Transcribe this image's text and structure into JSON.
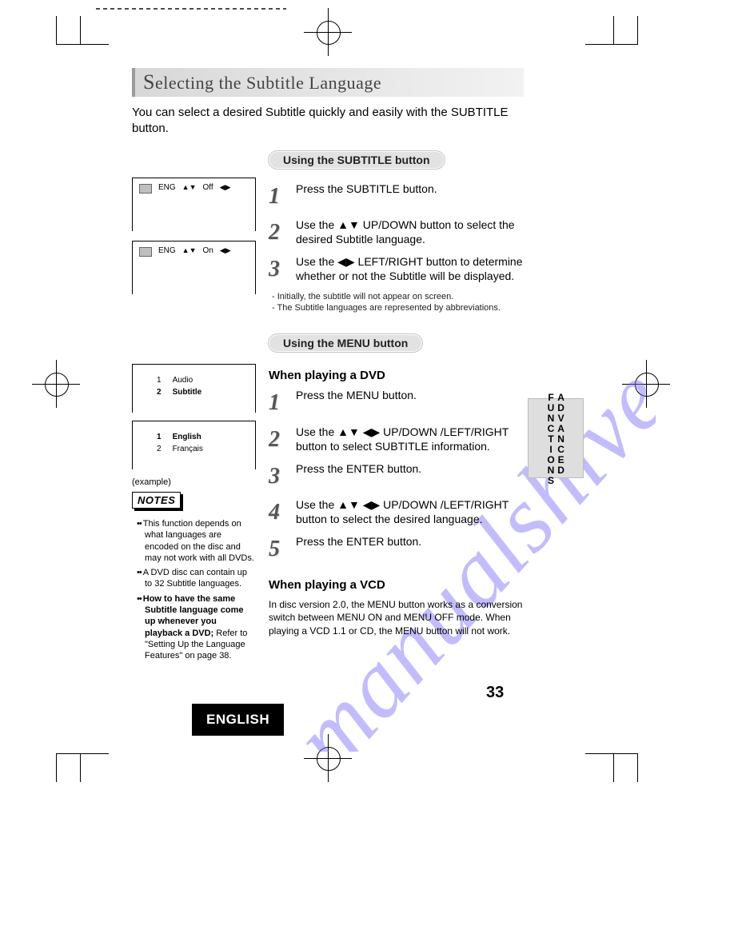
{
  "title_prefix": "S",
  "title_rest": "electing the Subtitle Language",
  "intro": "You can select a desired Subtitle quickly and easily with the SUBTITLE button.",
  "section1": {
    "heading": "Using the SUBTITLE button",
    "osd": [
      {
        "lang": "ENG",
        "state": "Off"
      },
      {
        "lang": "ENG",
        "state": "On"
      }
    ],
    "steps": [
      "Press the SUBTITLE button.",
      "Use the ▲▼ UP/DOWN button to select the desired Subtitle language.",
      "Use the ◀▶ LEFT/RIGHT button to determine whether or not the Subtitle will be displayed."
    ],
    "footnotes": [
      "- Initially, the subtitle will not appear on screen.",
      "- The Subtitle languages are represented by abbreviations."
    ]
  },
  "section2": {
    "heading": "Using the MENU button",
    "dvd_heading": "When playing a DVD",
    "menu_top": [
      {
        "n": "1",
        "label": "Audio",
        "bold": false
      },
      {
        "n": "2",
        "label": "Subtitle",
        "bold": true
      }
    ],
    "menu_bottom": [
      {
        "n": "1",
        "label": "English",
        "bold": true
      },
      {
        "n": "2",
        "label": "Français",
        "bold": false
      }
    ],
    "example_label": "(example)",
    "notes_heading": "NOTES",
    "notes": [
      "This function depends on what languages are encoded on the disc and may not work with all DVDs.",
      "A DVD disc can contain up to 32 Subtitle languages.",
      "How to have the same Subtitle language come up whenever you playback a DVD;"
    ],
    "notes_tail": "Refer to \"Setting Up the Language Features\" on page 38.",
    "steps": [
      "Press the MENU button.",
      "Use the ▲▼ ◀▶ UP/DOWN /LEFT/RIGHT button to select SUBTITLE information.",
      "Press the ENTER button.",
      "Use the ▲▼ ◀▶ UP/DOWN /LEFT/RIGHT button to select the desired language.",
      "Press the ENTER button."
    ],
    "vcd_heading": "When playing a VCD",
    "vcd_body": "In disc version 2.0, the MENU button works as a conversion switch between MENU ON and MENU OFF mode. When playing a VCD 1.1 or CD, the MENU button will not work."
  },
  "sidetab": "ADVANCED FUNCTIONS",
  "page_number": "33",
  "language_box": "ENGLISH",
  "watermark_text": "manualshive.com"
}
